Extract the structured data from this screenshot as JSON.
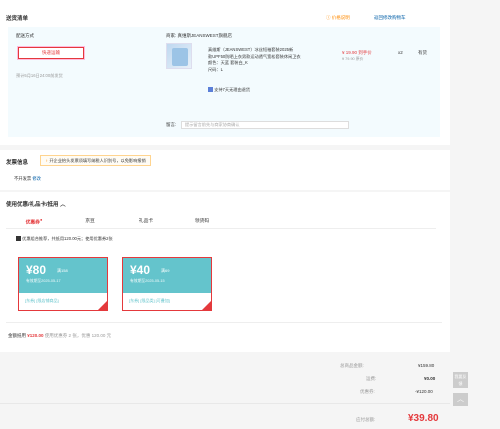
{
  "delivery": {
    "title": "送货清单",
    "price_info": "价格说明",
    "back_to_cart": "返回修改购物车",
    "method_label": "配送方式",
    "ship_method": "快递运输",
    "eta": "预计5月16日24:00前发货",
    "seller_label": "商家:",
    "seller_name": "真维斯JEANSWEST旗舰店",
    "product_name_line1": "真维斯（JEANSWEST）冰丝短袖套装2025新",
    "product_name_line2": "款UPF50防晒上衣男款运动透气宽松套装休闲卫衣",
    "product_color": "颜色：天蓝 套装白_K",
    "product_size": "尺码：L",
    "returns": "支持7天无理由退货",
    "price": "¥ 19.90 到手价",
    "price_original": "¥ 79.90 原价",
    "qty": "x2",
    "stock": "有货",
    "note_label": "留言:",
    "note_placeholder": "提示留言前先与商家协商确认"
  },
  "invoice": {
    "title": "发票信息",
    "hint": "开企业抬头发票须填写纳税人识别号，以免影响报销",
    "status": "不开发票",
    "edit": "修改"
  },
  "coupon_section": {
    "title": "使用优惠/礼品卡/抵用",
    "tabs": [
      "优惠券",
      "京豆",
      "礼品卡",
      "领货码"
    ],
    "summary": "优惠组合推荐，共抵用120.00元；使用优惠券2张",
    "coupons": [
      {
        "amount": "¥80",
        "condition": "满158",
        "expiry": "有效期至2025-05-17",
        "tags": "[东券] [限店铺商品]"
      },
      {
        "amount": "¥40",
        "condition": "满69",
        "expiry": "有效期至2025-05-15",
        "tags": "[东券] [限品类] [可叠加]"
      }
    ],
    "footer_label": "金额抵用",
    "footer_amount": "¥120.00",
    "footer_detail": "使用优惠券 2 张，优惠 120.00 元"
  },
  "summary": {
    "total_label": "总商品金额:",
    "total_value": "¥159.80",
    "shipping_label": "运费:",
    "shipping_value": "¥0.00",
    "discount_label": "优惠券:",
    "discount_value": "-¥120.00",
    "payable_label": "应付总额:",
    "payable_value": "¥39.80"
  },
  "side": {
    "feedback": "我要反馈"
  },
  "colors": {
    "accent": "#e4393c",
    "coupon": "#64c4cc",
    "link": "#005ea7"
  }
}
